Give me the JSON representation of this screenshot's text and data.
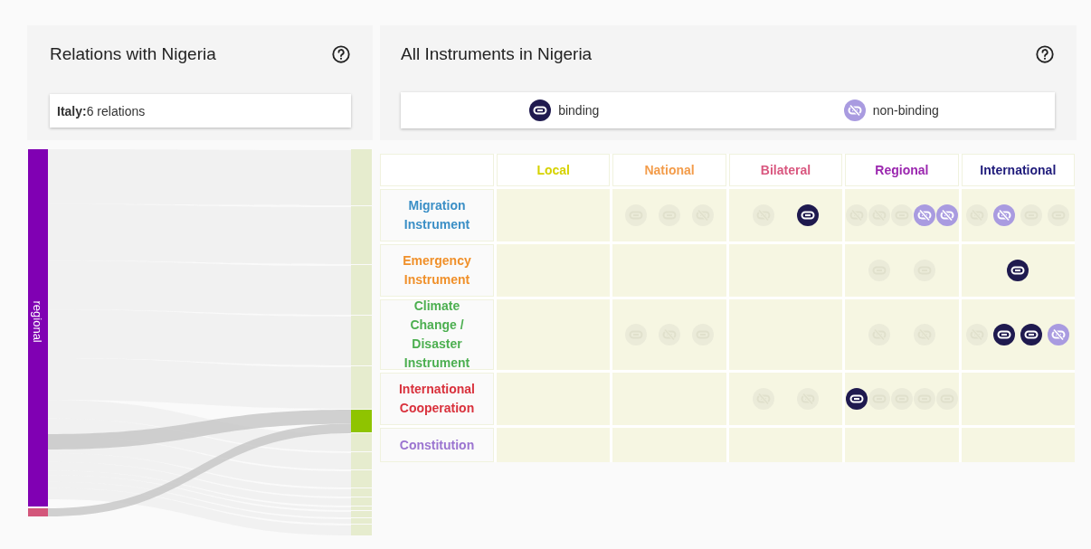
{
  "left_panel": {
    "title": "Relations with Nigeria",
    "info": "**Italy:**6 relations",
    "sankey": {
      "left_nodes": [
        {
          "label": "regional",
          "color": "#8000b3"
        },
        {
          "color": "#d3567a"
        }
      ],
      "right_nodes": [
        {
          "selected": false
        },
        {
          "selected": false
        },
        {
          "selected": false
        },
        {
          "selected": false
        },
        {
          "selected": false
        },
        {
          "selected": true
        },
        {
          "selected": false
        },
        {
          "selected": false
        },
        {
          "selected": false
        },
        {
          "selected": false
        },
        {
          "selected": false
        },
        {
          "selected": false
        },
        {
          "selected": false
        },
        {
          "selected": false
        },
        {
          "selected": false
        }
      ]
    }
  },
  "right_panel": {
    "title": "All Instruments in Nigeria",
    "legend": [
      {
        "kind": "binding",
        "label": "binding"
      },
      {
        "kind": "non-binding",
        "label": "non-binding"
      }
    ],
    "grid": {
      "columns": [
        {
          "label": "Local",
          "color": "#d6d200"
        },
        {
          "label": "National",
          "color": "#f39c4a"
        },
        {
          "label": "Bilateral",
          "color": "#d9577f"
        },
        {
          "label": "Regional",
          "color": "#9b27af"
        },
        {
          "label": "International",
          "color": "#1e1a7a"
        }
      ],
      "rows": [
        {
          "label": "Migration Instrument",
          "color": "#3b8fc6",
          "cells": [
            {},
            {
              "icons": [
                {
                  "kind": "binding",
                  "highlighted": false
                },
                {
                  "kind": "binding",
                  "highlighted": false
                },
                {
                  "kind": "non-binding",
                  "highlighted": false
                }
              ]
            },
            {
              "icons": [
                {
                  "kind": "non-binding",
                  "highlighted": false
                },
                {
                  "kind": "binding",
                  "highlighted": true
                }
              ]
            },
            {
              "icons": [
                {
                  "kind": "non-binding",
                  "highlighted": false
                },
                {
                  "kind": "non-binding",
                  "highlighted": false
                },
                {
                  "kind": "binding",
                  "highlighted": false
                },
                {
                  "kind": "non-binding",
                  "highlighted": true
                },
                {
                  "kind": "non-binding",
                  "highlighted": true
                }
              ]
            },
            {
              "icons": [
                {
                  "kind": "non-binding",
                  "highlighted": false
                },
                {
                  "kind": "non-binding",
                  "highlighted": true
                },
                {
                  "kind": "binding",
                  "highlighted": false
                },
                {
                  "kind": "binding",
                  "highlighted": false
                }
              ]
            }
          ]
        },
        {
          "label": "Emergency Instrument",
          "color": "#f0902a",
          "cells": [
            {},
            {},
            {},
            {
              "icons": [
                {
                  "kind": "binding",
                  "highlighted": false
                },
                {
                  "kind": "binding",
                  "highlighted": false
                }
              ]
            },
            {
              "icons": [
                {
                  "kind": "binding",
                  "highlighted": true
                }
              ]
            }
          ]
        },
        {
          "label": "Climate Change / Disaster Instrument",
          "color": "#4caf50",
          "cells": [
            {},
            {
              "icons": [
                {
                  "kind": "binding",
                  "highlighted": false
                },
                {
                  "kind": "non-binding",
                  "highlighted": false
                },
                {
                  "kind": "binding",
                  "highlighted": false
                }
              ]
            },
            {},
            {
              "icons": [
                {
                  "kind": "non-binding",
                  "highlighted": false
                },
                {
                  "kind": "non-binding",
                  "highlighted": false
                }
              ]
            },
            {
              "icons": [
                {
                  "kind": "non-binding",
                  "highlighted": false
                },
                {
                  "kind": "binding",
                  "highlighted": true
                },
                {
                  "kind": "binding",
                  "highlighted": true
                },
                {
                  "kind": "non-binding",
                  "highlighted": true
                }
              ]
            }
          ]
        },
        {
          "label": "International Cooperation",
          "color": "#d9313c",
          "cells": [
            {},
            {},
            {
              "icons": [
                {
                  "kind": "non-binding",
                  "highlighted": false
                },
                {
                  "kind": "non-binding",
                  "highlighted": false
                }
              ]
            },
            {
              "icons": [
                {
                  "kind": "binding",
                  "highlighted": true
                },
                {
                  "kind": "binding",
                  "highlighted": false
                },
                {
                  "kind": "binding",
                  "highlighted": false
                },
                {
                  "kind": "binding",
                  "highlighted": false
                },
                {
                  "kind": "binding",
                  "highlighted": false
                }
              ]
            },
            {}
          ]
        },
        {
          "label": "Constitution",
          "color": "#9b74d0",
          "cells": [
            {},
            {},
            {},
            {},
            {}
          ]
        }
      ]
    }
  }
}
